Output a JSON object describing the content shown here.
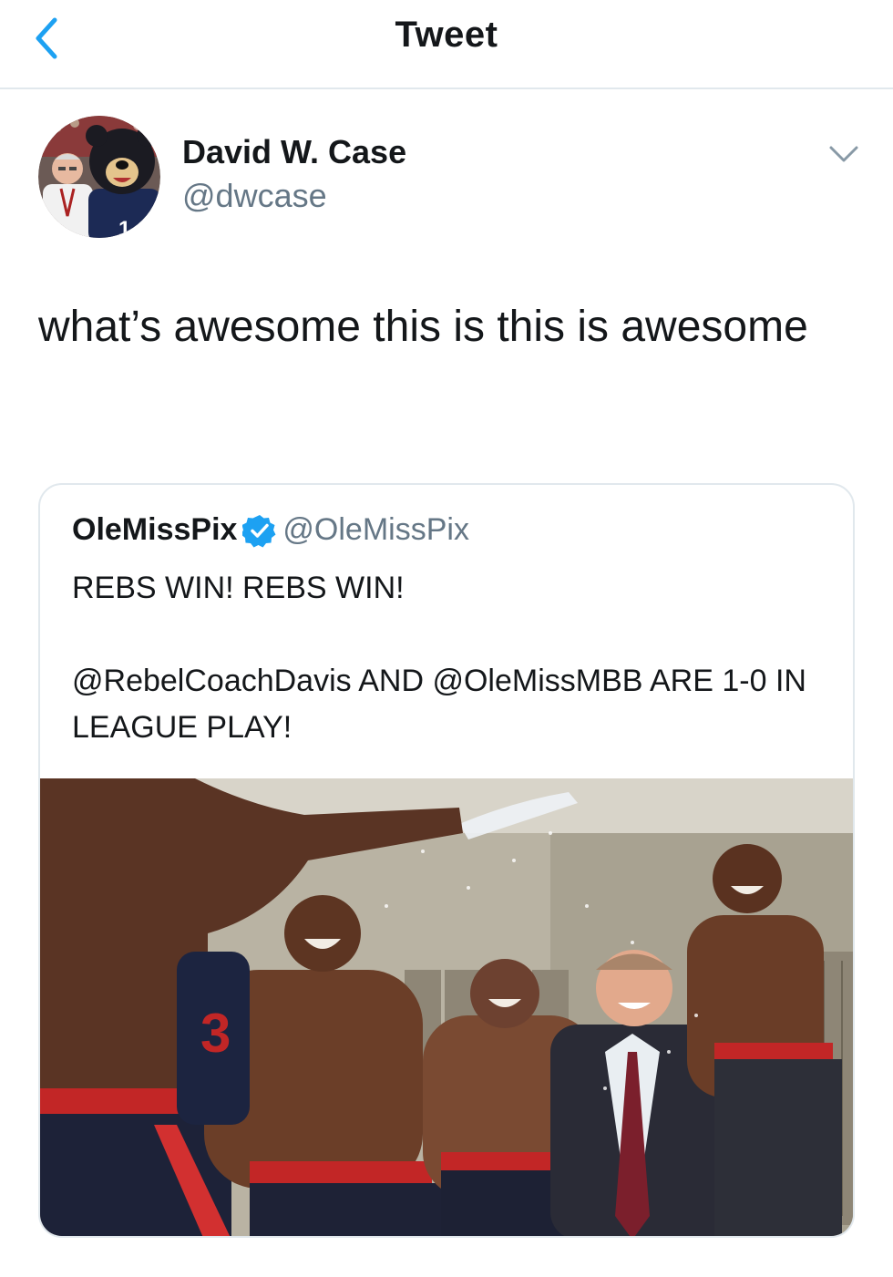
{
  "nav": {
    "title": "Tweet",
    "back_icon": "chevron-left-icon"
  },
  "author": {
    "name": "David W. Case",
    "handle": "@dwcase"
  },
  "tweet": {
    "text": "what’s awesome this is this is awesome"
  },
  "quoted_tweet": {
    "name": "OleMissPix",
    "handle": "@OleMissPix",
    "verified": true,
    "line1": "REBS WIN! REBS WIN!",
    "line2": "@RebelCoachDavis AND @OleMissMBB ARE 1-0 IN LEAGUE PLAY!"
  },
  "colors": {
    "accent": "#1da1f2",
    "secondary_text": "#657786",
    "border": "#e1e8ed"
  }
}
